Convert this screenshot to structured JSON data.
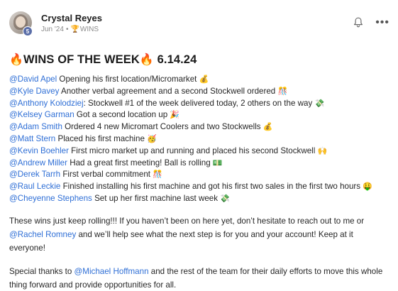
{
  "post": {
    "author": "Crystal Reyes",
    "level": "5",
    "date": "Jun '24",
    "separator": "•",
    "category_icon": "🏆",
    "category": "WINS",
    "header_icons": [
      "bell-icon",
      "more-options-icon"
    ],
    "title": {
      "emoji_left": "🔥",
      "text": "WINS OF THE WEEK",
      "emoji_right": "🔥",
      "date": "6.14.24"
    },
    "wins": [
      {
        "mention": "@David Apel",
        "text": " Opening his first location/Micromarket ",
        "emoji": "💰"
      },
      {
        "mention": "@Kyle Davey",
        "text": " Another verbal agreement and a second Stockwell ordered ",
        "emoji": "🎊"
      },
      {
        "mention": "@Anthony Kolodziej",
        "text": ": Stockwell #1 of the week delivered today, 2 others on the way ",
        "emoji": "💸"
      },
      {
        "mention": "@Kelsey Garman",
        "text": " Got a second location up ",
        "emoji": "🎉"
      },
      {
        "mention": "@Adam Smith",
        "text": " Ordered 4 new Micromart Coolers and two Stockwells ",
        "emoji": "💰"
      },
      {
        "mention": "@Matt Stern",
        "text": " Placed his first machine ",
        "emoji": "🥳"
      },
      {
        "mention": "@Kevin Boehler",
        "text": " First micro market up and running and placed his second Stockwell ",
        "emoji": "🙌"
      },
      {
        "mention": "@Andrew Miller",
        "text": " Had a great first meeting! Ball is rolling ",
        "emoji": "💵"
      },
      {
        "mention": "@Derek Tarrh",
        "text": " First verbal commitment ",
        "emoji": "🎊"
      },
      {
        "mention": "@Raul Leckie",
        "text": " Finished installing his first machine and got his first two sales in the first two hours ",
        "emoji": "🤑"
      },
      {
        "mention": "@Cheyenne Stephens",
        "text": " Set up her first machine last week ",
        "emoji": "💸"
      }
    ],
    "paragraph1": {
      "before": "These wins just keep rolling!!! If you haven’t been on here yet, don’t hesitate to reach out to me or ",
      "mention": "@Rachel Romney",
      "after": " and we’ll help see what the next step is for you and your account! Keep at it everyone!"
    },
    "paragraph2": {
      "before": "Special thanks to ",
      "mention": "@Michael Hoffmann",
      "after": " and the rest of the team for their daily efforts to move this whole thing forward and provide opportunities for all."
    },
    "colors": {
      "mention": "#2f6fd6",
      "text": "#262626",
      "meta": "#8a8a8a",
      "level_badge": "#5b6ea8"
    }
  }
}
